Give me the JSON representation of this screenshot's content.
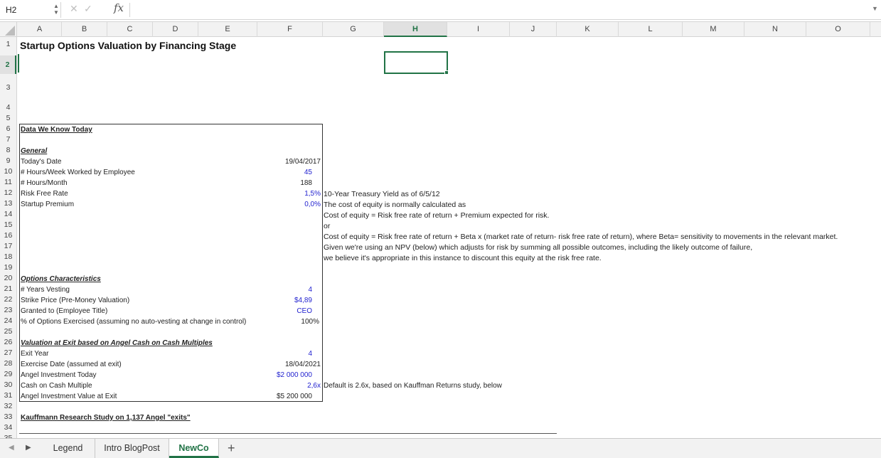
{
  "formula_bar": {
    "name_box": "H2",
    "stepper_up": "▲",
    "stepper_down": "▼",
    "cancel_glyph": "✕",
    "enter_glyph": "✓",
    "fx_label": "fx",
    "formula": "",
    "dropdown_glyph": "▼"
  },
  "columns": [
    "A",
    "B",
    "C",
    "D",
    "E",
    "F",
    "G",
    "H",
    "I",
    "J",
    "K",
    "L",
    "M",
    "N",
    "O"
  ],
  "selected_column": "H",
  "rows": [
    "1",
    "2",
    "3",
    "4",
    "5",
    "6",
    "7",
    "8",
    "9",
    "10",
    "11",
    "12",
    "13",
    "14",
    "15",
    "16",
    "17",
    "18",
    "19",
    "20",
    "21",
    "22",
    "23",
    "24",
    "25",
    "26",
    "27",
    "28",
    "29",
    "30",
    "31",
    "32",
    "33",
    "34",
    "35"
  ],
  "selected_row": "2",
  "sheet": {
    "title": "Startup Options Valuation by Financing Stage",
    "section_data_we_know": "Data We Know Today",
    "section_general": "General",
    "labels": {
      "todays_date": "Today's Date",
      "hours_week": "# Hours/Week Worked by Employee",
      "hours_month": "# Hours/Month",
      "risk_free": "Risk Free Rate",
      "startup_premium": "Startup Premium",
      "years_vesting": "# Years Vesting",
      "strike_price": "Strike Price (Pre-Money Valuation)",
      "granted_to": "Granted to (Employee Title)",
      "pct_exercised": "% of Options Exercised (assuming no auto-vesting at change in control)",
      "exit_year": "Exit Year",
      "exercise_date": "Exercise Date (assumed at exit)",
      "angel_investment": "Angel Investment Today",
      "cash_multiple": "Cash on Cash Multiple",
      "angel_exit_value": "Angel Investment Value at Exit"
    },
    "values": {
      "todays_date": "19/04/2017",
      "hours_week": "45",
      "hours_month": "188",
      "risk_free": "1,5%",
      "startup_premium": "0,0%",
      "years_vesting": "4",
      "strike_price": "$4,89",
      "granted_to": "CEO",
      "pct_exercised": "100%",
      "exit_year": "4",
      "exercise_date": "18/04/2021",
      "angel_investment": "$2 000 000",
      "cash_multiple": "2,6x",
      "angel_exit_value": "$5 200 000"
    },
    "section_options": "Options Characteristics",
    "section_valuation": "Valuation at Exit based on Angel Cash on Cash Multiples",
    "section_kauffmann": "Kauffmann Research Study on 1,137 Angel \"exits\"",
    "notes": {
      "r12": "10-Year Treasury Yield as of 6/5/12",
      "r13": "The cost of equity is normally calculated as",
      "r14": "Cost of equity = Risk free rate of return + Premium expected for risk.",
      "r15": "or",
      "r16": "Cost of equity = Risk free rate of return + Beta x (market rate of return- risk free rate of return), where Beta= sensitivity to movements in the relevant market.",
      "r17": "Given we're using an NPV (below) which adjusts for risk by summing all possible outcomes, including the likely outcome of failure,",
      "r18": "we believe it's appropriate in this instance to discount this equity at the risk free rate.",
      "r30": "Default is 2.6x, based on Kauffman Returns study, below"
    }
  },
  "tabs": {
    "prev_glyph": "◀",
    "next_glyph": "▶",
    "items": [
      "Legend",
      "Intro BlogPost",
      "NewCo"
    ],
    "active": "NewCo",
    "add_glyph": "+"
  },
  "colors": {
    "accent_green": "#217346",
    "input_blue": "#1f1fcf"
  }
}
